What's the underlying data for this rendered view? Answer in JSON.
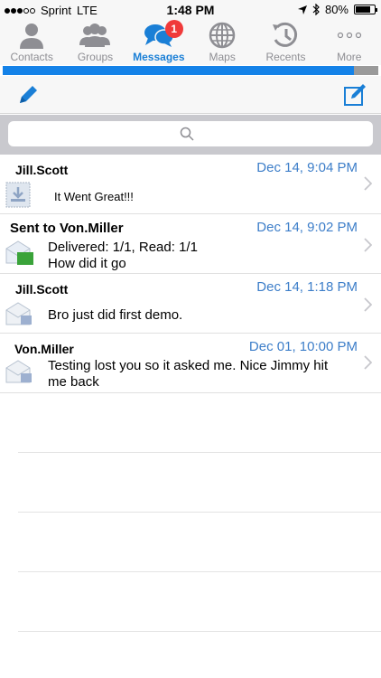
{
  "status_bar": {
    "carrier": "Sprint",
    "network": "LTE",
    "time": "1:48 PM",
    "battery_percent": "80%",
    "signal_bars_filled": 3,
    "signal_bars_total": 5,
    "battery_level": 0.8
  },
  "tabs": [
    {
      "label": "Contacts",
      "icon": "person-icon",
      "active": false
    },
    {
      "label": "Groups",
      "icon": "group-icon",
      "active": false
    },
    {
      "label": "Messages",
      "icon": "chat-bubbles-icon",
      "active": true,
      "badge": "1"
    },
    {
      "label": "Maps",
      "icon": "globe-icon",
      "active": false
    },
    {
      "label": "Recents",
      "icon": "history-icon",
      "active": false
    },
    {
      "label": "More",
      "icon": "more-dots-icon",
      "active": false
    }
  ],
  "progress": {
    "value": 0.935
  },
  "toolbar": {
    "left_icon": "pencil-icon",
    "right_icon": "compose-icon"
  },
  "search": {
    "placeholder": "",
    "value": "",
    "icon": "search-icon"
  },
  "messages": [
    {
      "sender": "Jill.Scott",
      "date": "Dec 14, 9:04 PM",
      "lines": [
        "It Went Great!!!"
      ],
      "icon": "incoming-message-icon"
    },
    {
      "sender": "Sent to Von.Miller",
      "date": "Dec 14, 9:02 PM",
      "lines": [
        "Delivered: 1/1, Read: 1/1",
        " How did it go"
      ],
      "icon": "sent-message-icon"
    },
    {
      "sender": "Jill.Scott",
      "date": "Dec 14, 1:18 PM",
      "lines": [
        "Bro just did first demo."
      ],
      "icon": "read-message-icon"
    },
    {
      "sender": "Von.Miller",
      "date": "Dec 01, 10:00 PM",
      "lines": [
        "Testing lost you so it asked me. Nice Jimmy hit",
        "me back"
      ],
      "icon": "read-message-icon"
    }
  ],
  "colors": {
    "accent": "#1a7fd6",
    "date_blue": "#3d7ec9",
    "badge_red": "#f03a3a",
    "progress_blue": "#1482e8"
  }
}
